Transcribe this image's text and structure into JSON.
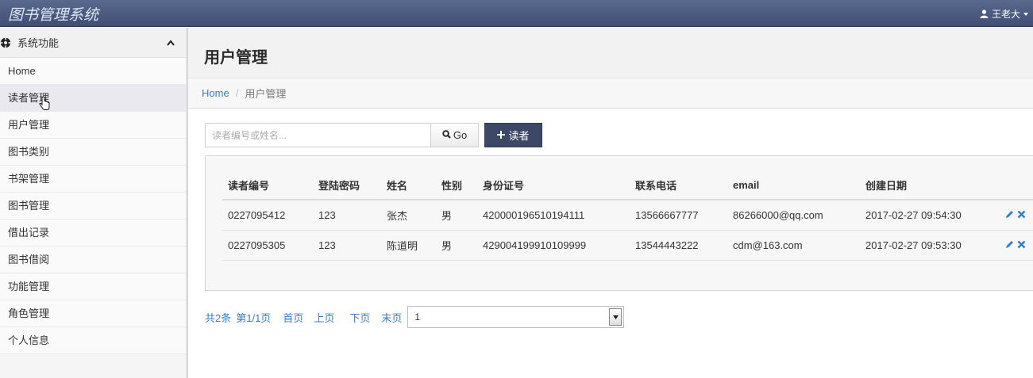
{
  "app": {
    "title": "图书管理系统",
    "user_name": "王老大"
  },
  "sidebar": {
    "header_label": "系统功能",
    "items": [
      {
        "label": "Home"
      },
      {
        "label": "读者管理"
      },
      {
        "label": "用户管理"
      },
      {
        "label": "图书类别"
      },
      {
        "label": "书架管理"
      },
      {
        "label": "图书管理"
      },
      {
        "label": "借出记录"
      },
      {
        "label": "图书借阅"
      },
      {
        "label": "功能管理"
      },
      {
        "label": "角色管理"
      },
      {
        "label": "个人信息"
      }
    ]
  },
  "page": {
    "title": "用户管理",
    "breadcrumb": {
      "home": "Home",
      "separator": "/",
      "current": "用户管理"
    }
  },
  "search": {
    "placeholder": "读者编号或姓名...",
    "go_label": "Go",
    "add_label": "读者"
  },
  "table": {
    "headers": [
      "读者编号",
      "登陆密码",
      "姓名",
      "性别",
      "身份证号",
      "联系电话",
      "email",
      "创建日期"
    ],
    "rows": [
      [
        "0227095412",
        "123",
        "张杰",
        "男",
        "420000196510194111",
        "13566667777",
        "86266000@qq.com",
        "2017-02-27 09:54:30"
      ],
      [
        "0227095305",
        "123",
        "陈道明",
        "男",
        "429004199910109999",
        "13544443222",
        "cdm@163.com",
        "2017-02-27 09:53:30"
      ]
    ]
  },
  "pager": {
    "total": "共2条",
    "page_info": "第1/1页",
    "first": "首页",
    "prev": "上页",
    "next": "下页",
    "last": "末页",
    "selected_page": "1"
  },
  "colors": {
    "topbar": "#4a5a7e",
    "link": "#3a7cc4",
    "add_button": "#3c4866",
    "action_icon": "#2a7fd0"
  }
}
